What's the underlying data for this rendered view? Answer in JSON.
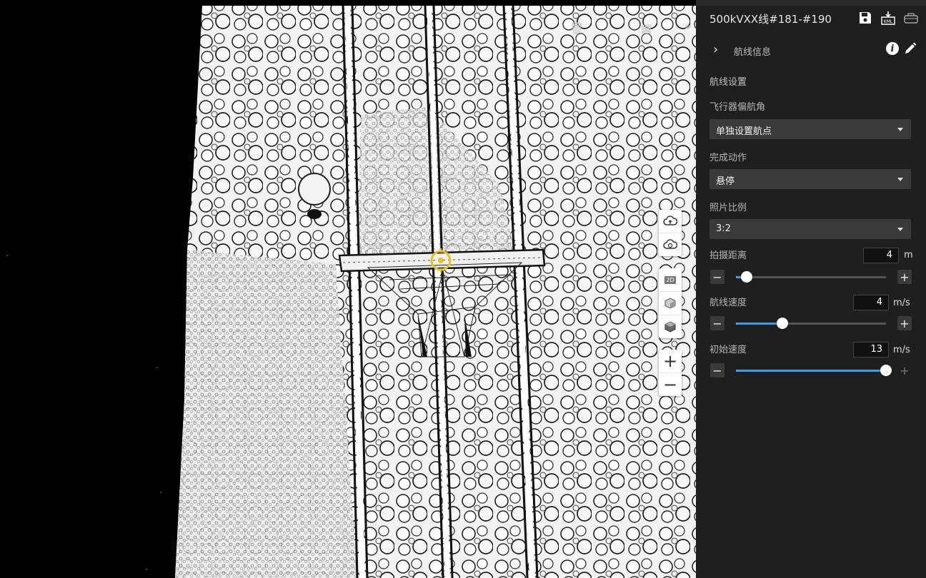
{
  "route": {
    "title": "500kVXX线#181-#190"
  },
  "toolbar": {
    "save_icon": "save-icon",
    "export_kml_icon": "kml-export-icon",
    "kml_badge": "KML",
    "dock_icon": "drone-dock-icon"
  },
  "section": {
    "label": "航线信息",
    "chevron": "›"
  },
  "settings": {
    "heading": "航线设置",
    "heading_mode_label": "飞行器偏航角",
    "heading_mode_value": "单独设置航点",
    "finish_action_label": "完成动作",
    "finish_action_value": "悬停",
    "photo_ratio_label": "照片比例",
    "photo_ratio_value": "3:2",
    "shoot_distance": {
      "label": "拍摄距离",
      "value": "4",
      "unit": "m",
      "fraction": 0.07
    },
    "route_speed": {
      "label": "航线速度",
      "value": "4",
      "unit": "m/s",
      "fraction": 0.31
    },
    "initial_speed": {
      "label": "初始速度",
      "value": "13",
      "unit": "m/s",
      "fraction": 1.0
    }
  },
  "map_tools": {
    "zoom_in": "+",
    "zoom_out": "−",
    "collapse": "»",
    "view_2d_label": "2D"
  },
  "colors": {
    "accent": "#3d9be9",
    "panel_bg": "#1f1f1f",
    "dropdown_bg": "#3a3a3a",
    "waypoint": "#e8c21c"
  }
}
